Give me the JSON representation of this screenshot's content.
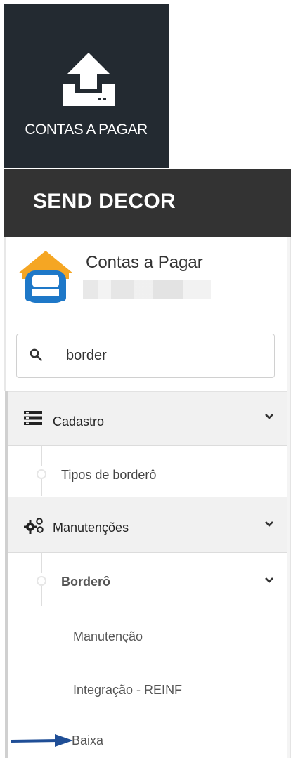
{
  "tile": {
    "label": "CONTAS A PAGAR",
    "icon": "upload-icon"
  },
  "brand": {
    "name": "SEND DECOR"
  },
  "app": {
    "title": "Contas a Pagar",
    "avatar_icon": "sofa-house-icon"
  },
  "search": {
    "value": "border",
    "icon": "search-icon"
  },
  "menu": {
    "cadastro": {
      "label": "Cadastro",
      "icon": "list-icon",
      "items": [
        {
          "label": "Tipos de borderô"
        }
      ]
    },
    "manutencoes": {
      "label": "Manutenções",
      "icon": "gears-icon",
      "bordero": {
        "label": "Borderô",
        "items": [
          {
            "label": "Manutenção"
          },
          {
            "label": "Integração - REINF"
          },
          {
            "label": "Baixa"
          }
        ]
      }
    }
  },
  "colors": {
    "tile_bg": "#232a31",
    "brand_bg": "#333333",
    "avatar_orange": "#f5a623",
    "avatar_blue": "#1e78c8",
    "arrow": "#1f4e96"
  }
}
